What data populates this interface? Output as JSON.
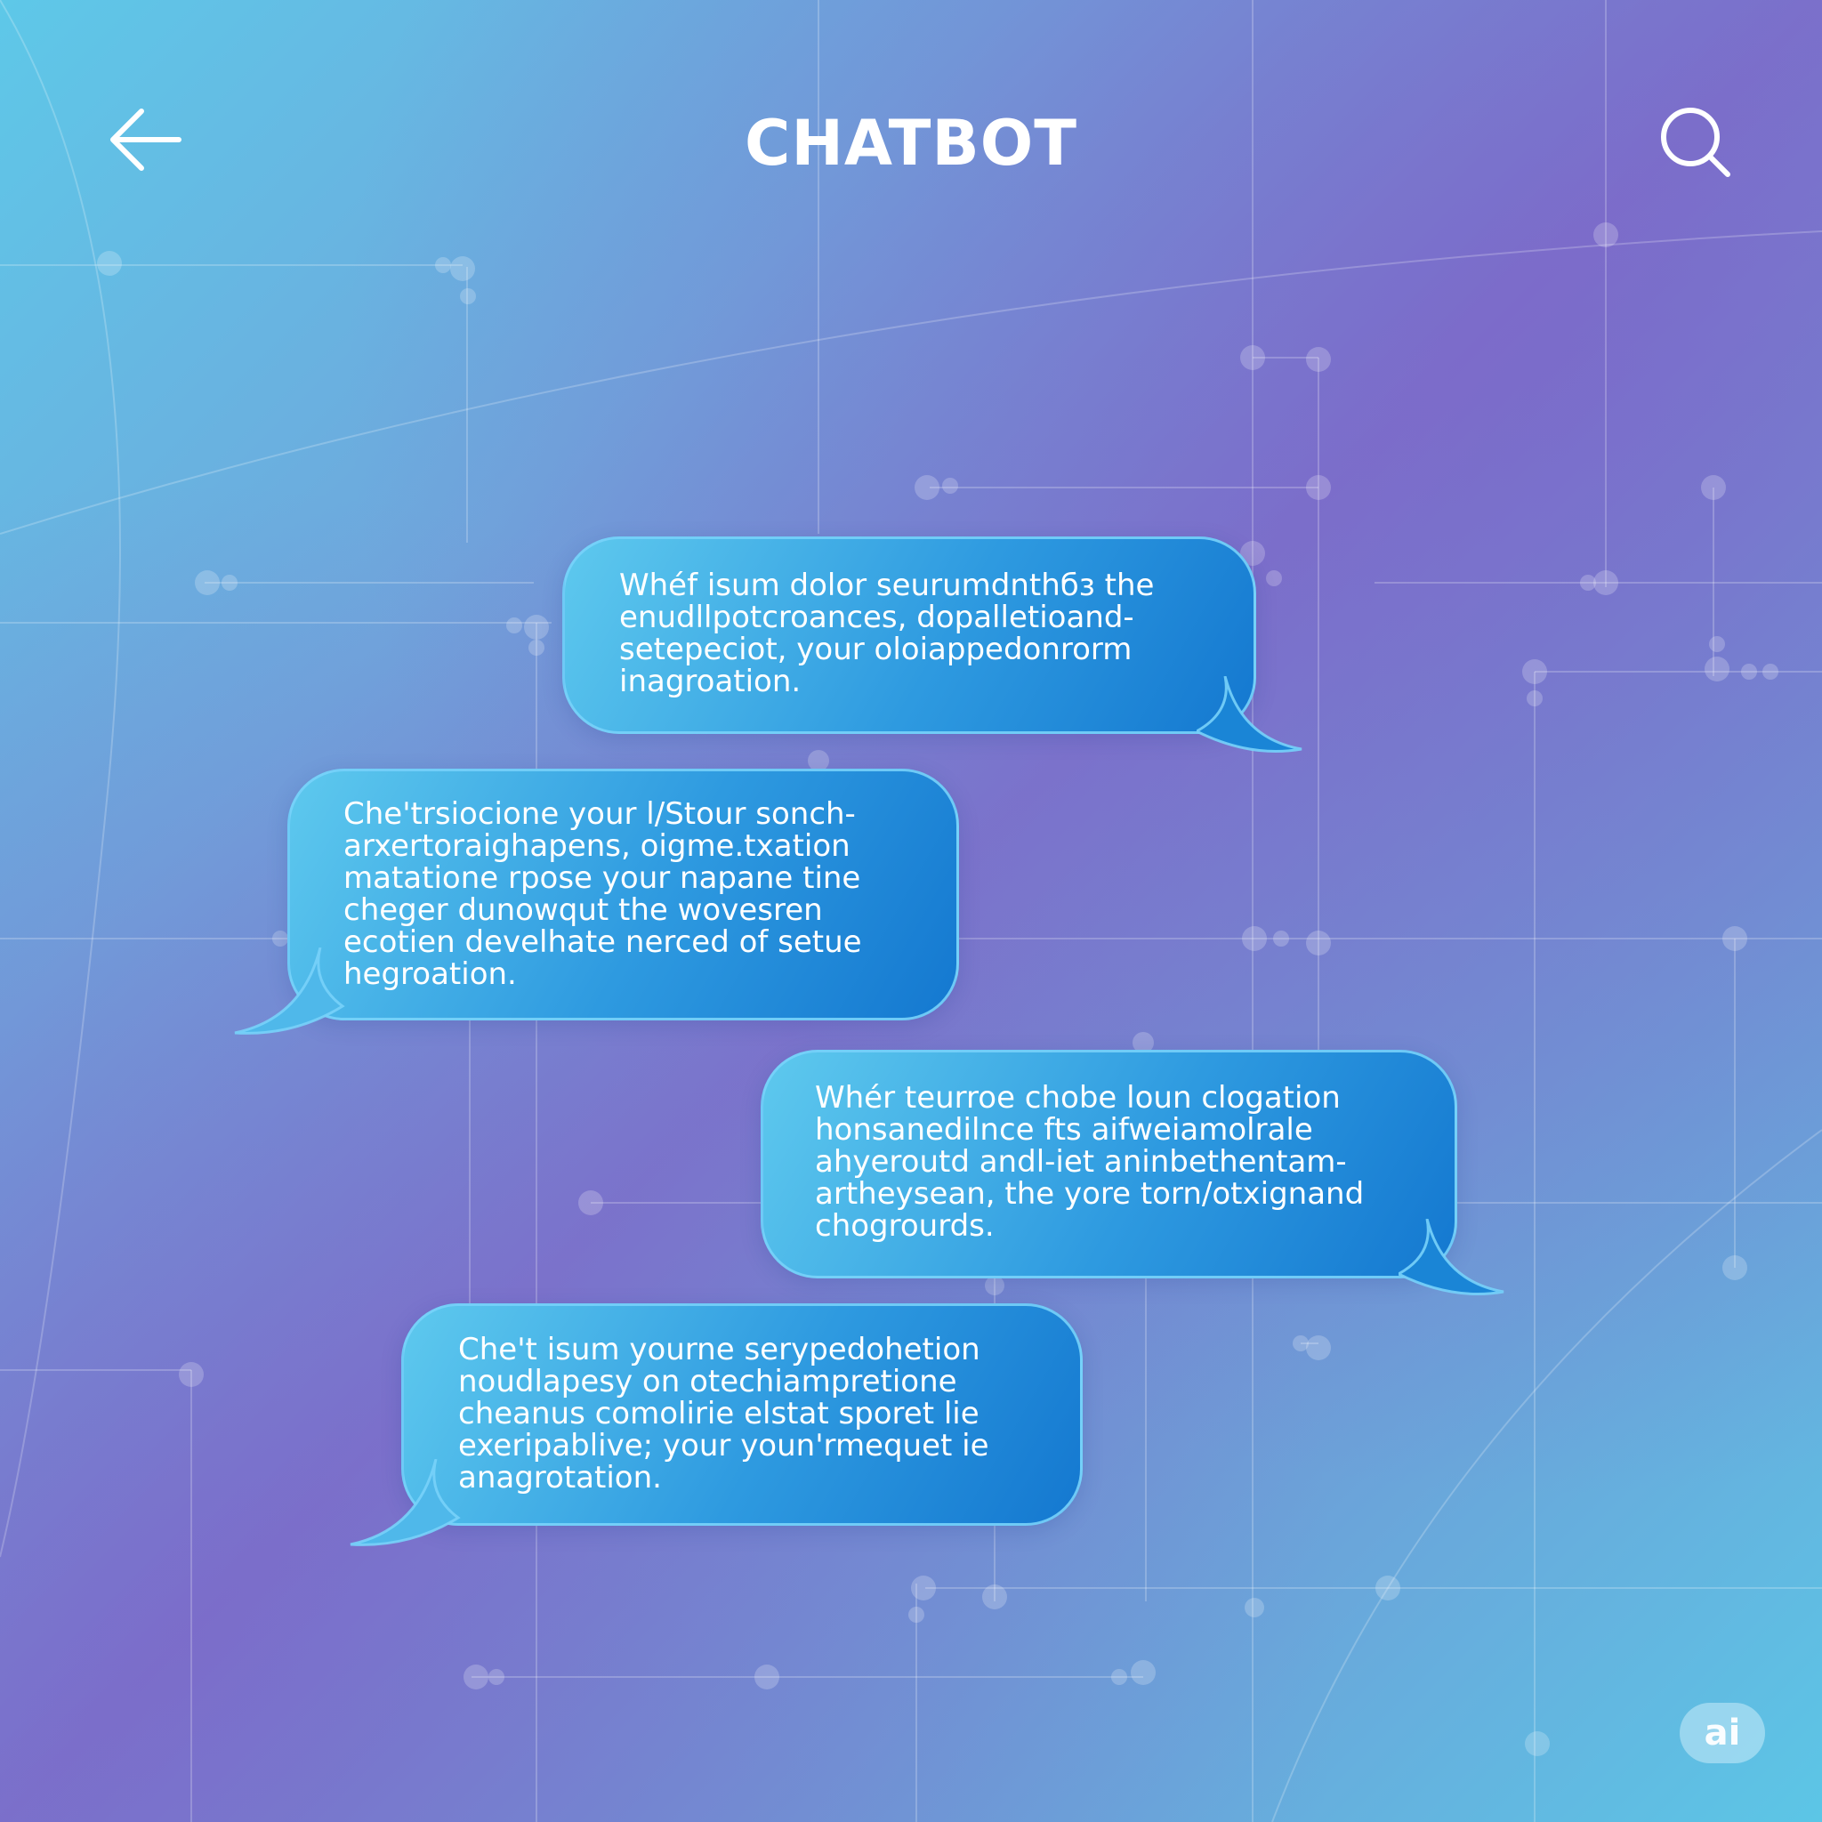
{
  "header": {
    "title": "CHATBOT",
    "back_icon": "arrow-left-icon",
    "search_icon": "search-icon"
  },
  "messages": [
    {
      "side": "right",
      "text": "Whéf isum dolor seurumdnthбз the\nenudllpotcroances, dopalletioand-\nsetepeciot, your oloiappedonrorm\ninagroation."
    },
    {
      "side": "left",
      "text": "Che'trsiocione your l/Stour sonch-\narxertoraighapens, oigme.txation\nmatatione rpose your napane tine\ncheger dunowqut the wovesren\necotien develhate nerced of setue\nhegroation."
    },
    {
      "side": "right",
      "text": "Whér teurroe chobe loun clogation\nhonsanedilnce fts aifweiamolrale\nahyeroutd andl-iet aninbethentam-\nartheysean, the yore torn/otxignand\nchogrourds."
    },
    {
      "side": "left",
      "text": "Che't isum yourne serypedohetion\nnoudlapesy on otechiampretione\ncheanus comolirie elstat sporet lie\nexeripablive; your youn'rmequet ie\nanagrotation."
    }
  ],
  "badge": {
    "label": "ai"
  },
  "colors": {
    "bubble_start": "#5ec9ee",
    "bubble_end": "#1478d0",
    "bg_cyan": "#5ec8e8",
    "bg_purple": "#7a78cc"
  }
}
